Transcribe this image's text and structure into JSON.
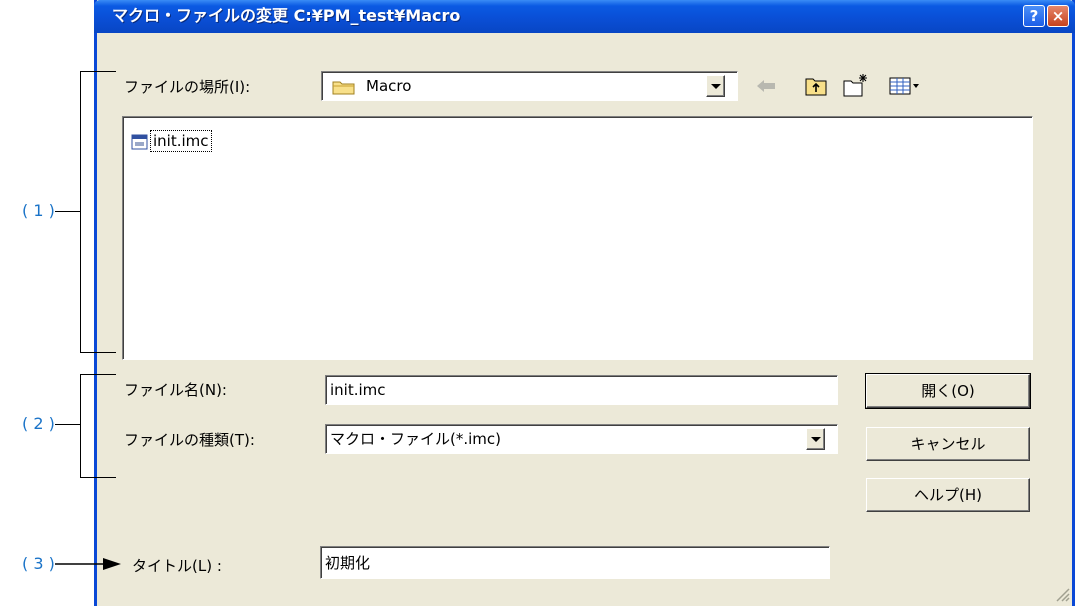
{
  "dialog": {
    "title": "マクロ・ファイルの変更  C:¥PM_test¥Macro",
    "help_glyph": "?",
    "close_glyph": "×"
  },
  "location": {
    "label": "ファイルの場所(I):",
    "value": "Macro"
  },
  "files": [
    {
      "name": "init.imc"
    }
  ],
  "filename": {
    "label": "ファイル名(N):",
    "value": "init.imc"
  },
  "filetype": {
    "label": "ファイルの種類(T):",
    "value": "マクロ・ファイル(*.imc)"
  },
  "title_field": {
    "label": "タイトル(L) :",
    "value": "初期化"
  },
  "buttons": {
    "open": "開く(O)",
    "cancel": "キャンセル",
    "help": "ヘルプ(H)"
  },
  "annotations": {
    "one": "( 1 )",
    "two": "( 2 )",
    "three": "( 3 )"
  },
  "colors": {
    "annotation": "#1a73c8",
    "titlebar": "#0a4fd6"
  }
}
